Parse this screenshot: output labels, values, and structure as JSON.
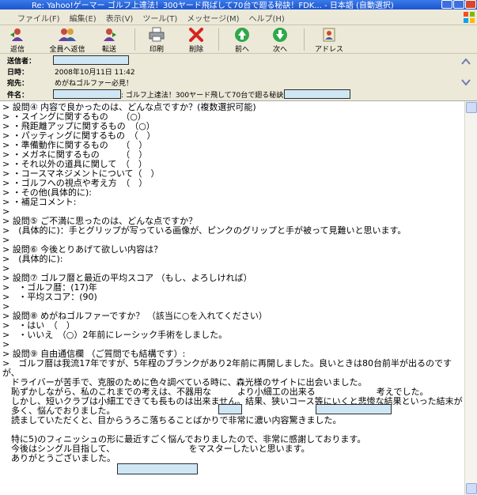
{
  "window": {
    "title": "Re: Yahoo!ゲーマー ゴルフ上達法！300ヤード飛ばして70台で廻る秘訣！FDK...  - 日本語 (自動選択)"
  },
  "menu": [
    "ファイル(F)",
    "編集(E)",
    "表示(V)",
    "ツール(T)",
    "メッセージ(M)",
    "ヘルプ(H)"
  ],
  "toolbar": {
    "reply": "返信",
    "reply_all": "全員へ返信",
    "forward": "転送",
    "print": "印刷",
    "delete": "削除",
    "previous": "前へ",
    "next": "次へ",
    "addresses": "アドレス"
  },
  "header": {
    "from_label": "送信者：",
    "date_label": "日時：",
    "date_value": "2008年10月11日 11:42",
    "to_label": "宛先：",
    "to_value": "めがねゴルファー必見！",
    "subject_label": "件名：",
    "subject_value": ": ゴルフ上達法！300ヤード飛して70台で廻る秘訣: "
  },
  "body": {
    "lines": [
      "> 設問④ 内容で良かったのは、どんな点ですか？(複数選択可能)",
      "> ・スイングに関するもの　　（○）",
      "> ・飛距離アップに関するもの　（○）",
      "> ・パッティングに関するもの　（　）",
      "> ・準備動作に関するもの　　（　）",
      "> ・メガネに関するもの　　　（　）",
      "> ・それ以外の道具に関して　（　）",
      "> ・コースマネジメントについて（　）",
      "> ・ゴルフへの視点や考え方　（　）",
      "> ・その他(具体的に):",
      "> ・補足コメント:",
      ">",
      "> 設問⑤ ご不満に思ったのは、どんな点ですか？",
      ">　(具体的に)：手とグリップが写っている画像が、ピンクのグリップと手が被って見難いと思います。",
      ">",
      "> 設問⑥ 今後とりあげて欲しい内容は？",
      ">　(具体的に):",
      ">",
      "> 設問⑦ ゴルフ暦と最近の平均スコア （もし、よろしければ）",
      ">　・ゴルフ暦：(17)年",
      ">　・平均スコア：(90)",
      ">",
      "> 設問⑧ めがねゴルファーですか？ （該当に○を入れてください）",
      ">　・はい　（　）",
      ">　・いいえ　（○）2年前にレーシック手術をしました。",
      ">",
      "> 設問⑨ 自由通信欄 （ご質問でも結構です）:",
      ">　ゴルフ暦は我流17年ですが、5年程のブランクがあり2年前に再開しました。良いときは80台前半が出るのです",
      "が、",
      "　ドライバーが苦手で、克服のために色々調べている時に、森光様のサイトに出会いました。",
      "　恥ずかしながら、私のこれまでの考えは、不器用な　　　より小細工の出来る　　　　　　　考えでした。",
      "　しかし、短いクラブは小細工できても長ものは出来ません。結果、狭いコース等にいくと悲惨な結果といった結末が",
      "　多く、悩んでおりました。",
      "　読ましていただくと、目からうろこ落ちることばかりで非常に濃い内容驚きました。",
      "",
      "　特に5)のフィニッシュの形に最近すごく悩んでおりましたので、非常に感謝しております。",
      "　今後はシングル目指して、　　　　　　　　　をマスターしたいと思います。",
      "　ありがとうございました。"
    ]
  },
  "colors": {
    "title_bar": "#1d55d0",
    "chrome": "#ece9d8",
    "redaction_fill": "#cfe7f5"
  },
  "icons": {
    "reply": "reply-icon",
    "reply_all": "reply-all-icon",
    "forward": "forward-icon",
    "print": "printer-icon",
    "delete": "delete-x-icon",
    "previous": "up-arrow-icon",
    "next": "down-arrow-icon",
    "addresses": "address-book-icon"
  }
}
